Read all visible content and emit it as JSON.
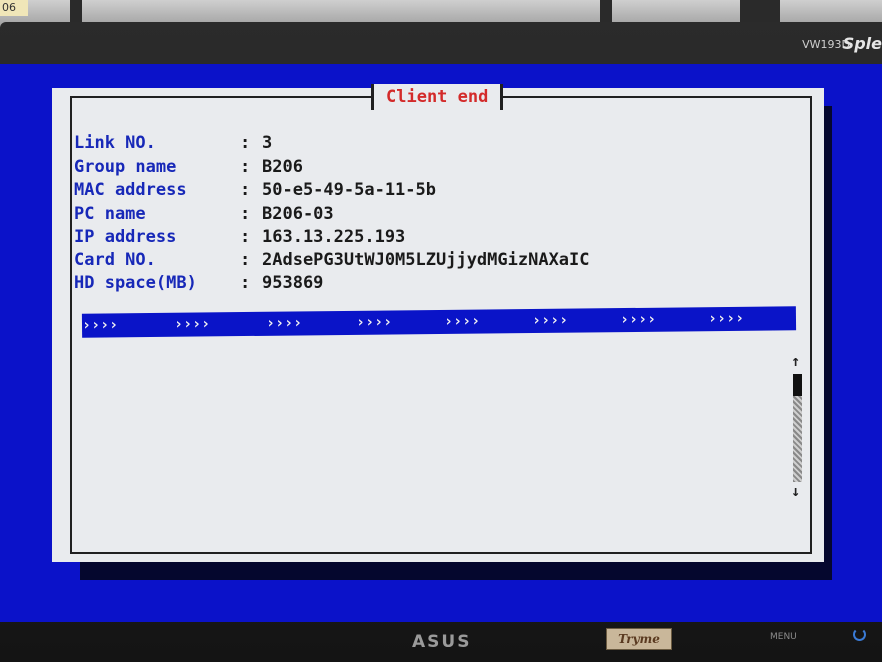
{
  "environment": {
    "corner_label": "06"
  },
  "monitor": {
    "model": "VW193D",
    "brand_partial": "Sple",
    "logo": "ASUS",
    "sticker": "Tryme",
    "menu_label": "MENU",
    "power_icon": "power-icon"
  },
  "window": {
    "title": "Client end",
    "colors": {
      "screen_bg": "#0b12c9",
      "panel_bg": "#e9ebee",
      "label_color": "#1728b8",
      "title_color": "#d32a2a"
    }
  },
  "info": {
    "separator": ":",
    "rows": [
      {
        "label": "Link NO.",
        "value": "3"
      },
      {
        "label": "Group name",
        "value": "B206"
      },
      {
        "label": "MAC address",
        "value": "50-e5-49-5a-11-5b"
      },
      {
        "label": "PC name",
        "value": "B206-03"
      },
      {
        "label": "IP address",
        "value": "163.13.225.193"
      },
      {
        "label": "Card NO.",
        "value": "2AdsePG3UtWJ0M5LZUjjydMGizNAXaIC"
      },
      {
        "label": "HD space(MB)",
        "value": "953869"
      }
    ]
  },
  "progress": {
    "segment_text": "››››",
    "segments": [
      "››››",
      "››››",
      "››››",
      "››››",
      "››››",
      "››››",
      "››››",
      "››››"
    ]
  },
  "scrollbar": {
    "up_arrow": "↑",
    "down_arrow": "↓"
  }
}
